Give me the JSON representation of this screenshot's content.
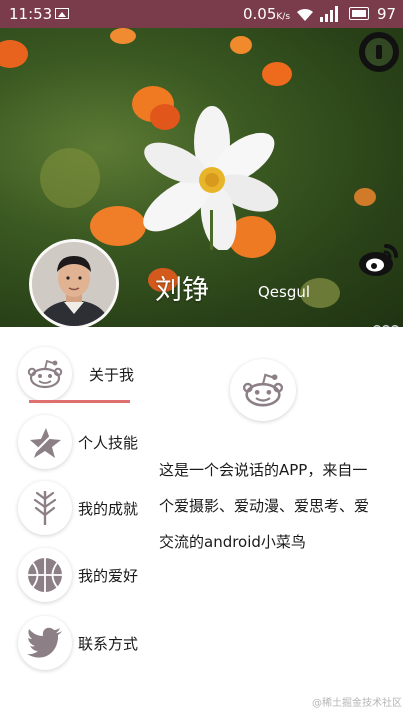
{
  "status_bar": {
    "time": "11:53",
    "speed": "0.05",
    "speed_unit": "K/s",
    "battery": "97"
  },
  "profile": {
    "name": "刘铮",
    "nickname": "Qesgul"
  },
  "menu": [
    {
      "label": "关于我",
      "icon": "reddit-icon",
      "active": true
    },
    {
      "label": "个人技能",
      "icon": "skill-star-icon"
    },
    {
      "label": "我的成就",
      "icon": "leaf-icon"
    },
    {
      "label": "我的爱好",
      "icon": "basketball-icon"
    },
    {
      "label": "联系方式",
      "icon": "twitter-bird-icon"
    }
  ],
  "content": {
    "icon": "reddit-icon",
    "description": "这是一个会说话的APP，来自一个爱摄影、爱动漫、爱思考、爱交流的android小菜鸟"
  },
  "watermark": "@稀土掘金技术社区",
  "colors": {
    "status_bar": "#7a3b4b",
    "active_indicator": "#e07070",
    "icon_grey": "#8c7f86"
  }
}
